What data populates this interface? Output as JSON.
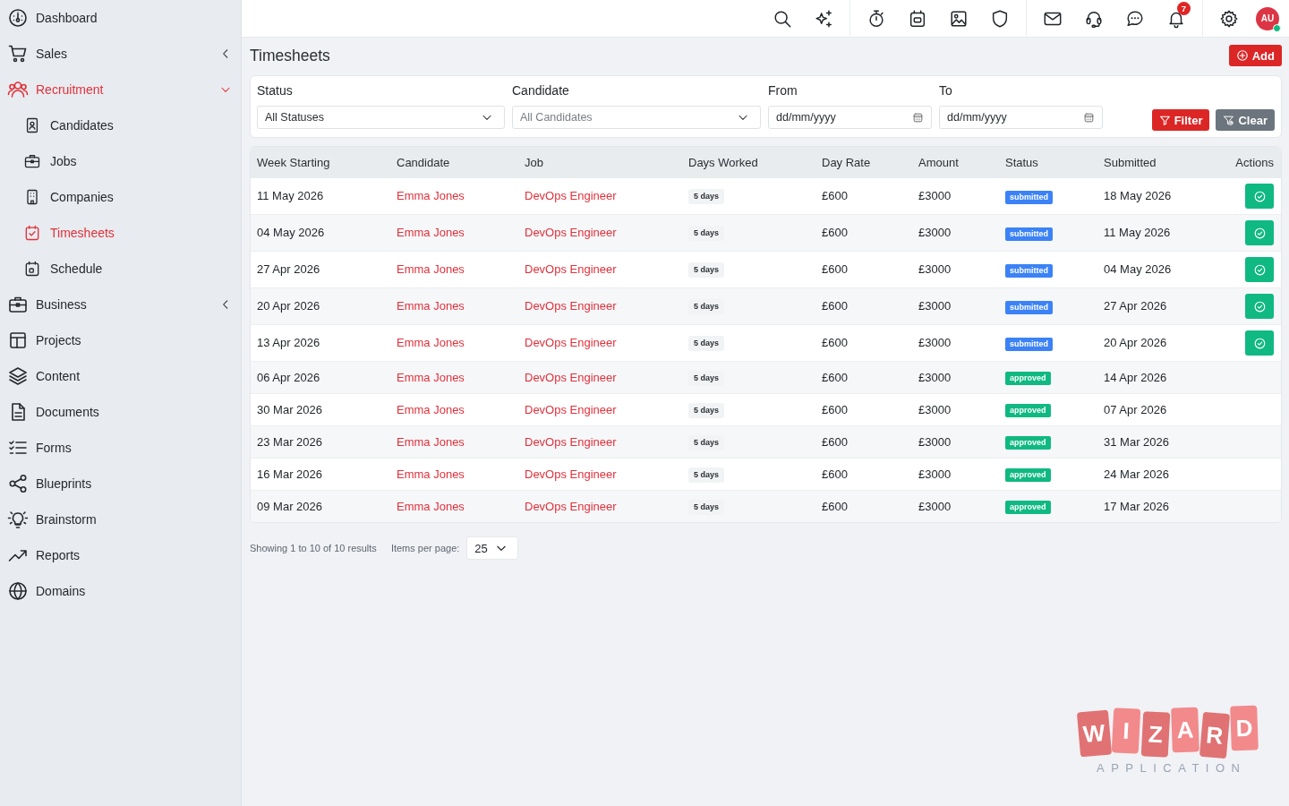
{
  "sidebar": {
    "items": [
      {
        "label": "Dashboard",
        "kind": "link",
        "selected": false
      },
      {
        "label": "Sales",
        "kind": "group",
        "selected": false,
        "expanded": false
      },
      {
        "label": "Recruitment",
        "kind": "group",
        "selected": true,
        "expanded": true,
        "children": [
          {
            "label": "Candidates",
            "selected": false
          },
          {
            "label": "Jobs",
            "selected": false
          },
          {
            "label": "Companies",
            "selected": false
          },
          {
            "label": "Timesheets",
            "selected": true
          },
          {
            "label": "Schedule",
            "selected": false
          }
        ]
      },
      {
        "label": "Business",
        "kind": "group",
        "selected": false,
        "expanded": false
      },
      {
        "label": "Projects",
        "kind": "link",
        "selected": false
      },
      {
        "label": "Content",
        "kind": "link",
        "selected": false
      },
      {
        "label": "Documents",
        "kind": "link",
        "selected": false
      },
      {
        "label": "Forms",
        "kind": "link",
        "selected": false
      },
      {
        "label": "Blueprints",
        "kind": "link",
        "selected": false
      },
      {
        "label": "Brainstorm",
        "kind": "link",
        "selected": false
      },
      {
        "label": "Reports",
        "kind": "link",
        "selected": false
      },
      {
        "label": "Domains",
        "kind": "link",
        "selected": false
      }
    ]
  },
  "toolbar": {
    "notification_count": "7",
    "avatar": {
      "initials": "AU",
      "online": true
    }
  },
  "page": {
    "title": "Timesheets",
    "add_button": "Add"
  },
  "filters": {
    "fields": [
      {
        "label": "Status",
        "kind": "select",
        "value": "All Statuses"
      },
      {
        "label": "Candidate",
        "kind": "select",
        "placeholder": "All Candidates"
      },
      {
        "label": "From",
        "kind": "date",
        "placeholder": "dd/mm/yyyy"
      },
      {
        "label": "To",
        "kind": "date",
        "placeholder": "dd/mm/yyyy"
      }
    ],
    "buttons": [
      {
        "label": "Filter",
        "kind": "primary"
      },
      {
        "label": "Clear",
        "kind": "secondary"
      }
    ]
  },
  "table": {
    "columns": [
      "Week Starting",
      "Candidate",
      "Job",
      "Days Worked",
      "Day Rate",
      "Amount",
      "Status",
      "Submitted",
      "Actions"
    ],
    "rows": [
      {
        "week_starting": "11 May 2026",
        "candidate": "Emma Jones",
        "job": "DevOps Engineer",
        "days_worked": "5 days",
        "day_rate": "£600",
        "amount": "£3000",
        "status": {
          "label": "submitted",
          "color": "#3b82f6"
        },
        "submitted": "18 May 2026",
        "can_approve": true
      },
      {
        "week_starting": "04 May 2026",
        "candidate": "Emma Jones",
        "job": "DevOps Engineer",
        "days_worked": "5 days",
        "day_rate": "£600",
        "amount": "£3000",
        "status": {
          "label": "submitted",
          "color": "#3b82f6"
        },
        "submitted": "11 May 2026",
        "can_approve": true
      },
      {
        "week_starting": "27 Apr 2026",
        "candidate": "Emma Jones",
        "job": "DevOps Engineer",
        "days_worked": "5 days",
        "day_rate": "£600",
        "amount": "£3000",
        "status": {
          "label": "submitted",
          "color": "#3b82f6"
        },
        "submitted": "04 May 2026",
        "can_approve": true
      },
      {
        "week_starting": "20 Apr 2026",
        "candidate": "Emma Jones",
        "job": "DevOps Engineer",
        "days_worked": "5 days",
        "day_rate": "£600",
        "amount": "£3000",
        "status": {
          "label": "submitted",
          "color": "#3b82f6"
        },
        "submitted": "27 Apr 2026",
        "can_approve": true
      },
      {
        "week_starting": "13 Apr 2026",
        "candidate": "Emma Jones",
        "job": "DevOps Engineer",
        "days_worked": "5 days",
        "day_rate": "£600",
        "amount": "£3000",
        "status": {
          "label": "submitted",
          "color": "#3b82f6"
        },
        "submitted": "20 Apr 2026",
        "can_approve": true
      },
      {
        "week_starting": "06 Apr 2026",
        "candidate": "Emma Jones",
        "job": "DevOps Engineer",
        "days_worked": "5 days",
        "day_rate": "£600",
        "amount": "£3000",
        "status": {
          "label": "approved",
          "color": "#10b981"
        },
        "submitted": "14 Apr 2026",
        "can_approve": false
      },
      {
        "week_starting": "30 Mar 2026",
        "candidate": "Emma Jones",
        "job": "DevOps Engineer",
        "days_worked": "5 days",
        "day_rate": "£600",
        "amount": "£3000",
        "status": {
          "label": "approved",
          "color": "#10b981"
        },
        "submitted": "07 Apr 2026",
        "can_approve": false
      },
      {
        "week_starting": "23 Mar 2026",
        "candidate": "Emma Jones",
        "job": "DevOps Engineer",
        "days_worked": "5 days",
        "day_rate": "£600",
        "amount": "£3000",
        "status": {
          "label": "approved",
          "color": "#10b981"
        },
        "submitted": "31 Mar 2026",
        "can_approve": false
      },
      {
        "week_starting": "16 Mar 2026",
        "candidate": "Emma Jones",
        "job": "DevOps Engineer",
        "days_worked": "5 days",
        "day_rate": "£600",
        "amount": "£3000",
        "status": {
          "label": "approved",
          "color": "#10b981"
        },
        "submitted": "24 Mar 2026",
        "can_approve": false
      },
      {
        "week_starting": "09 Mar 2026",
        "candidate": "Emma Jones",
        "job": "DevOps Engineer",
        "days_worked": "5 days",
        "day_rate": "£600",
        "amount": "£3000",
        "status": {
          "label": "approved",
          "color": "#10b981"
        },
        "submitted": "17 Mar 2026",
        "can_approve": false
      }
    ]
  },
  "pagination": {
    "summary": "Showing 1 to 10 of 10 results",
    "per_page_label": "Items per page:",
    "per_page": "25"
  },
  "logo": {
    "letters": [
      "W",
      "I",
      "Z",
      "A",
      "R",
      "D"
    ],
    "tagline": "APPLICATION"
  }
}
